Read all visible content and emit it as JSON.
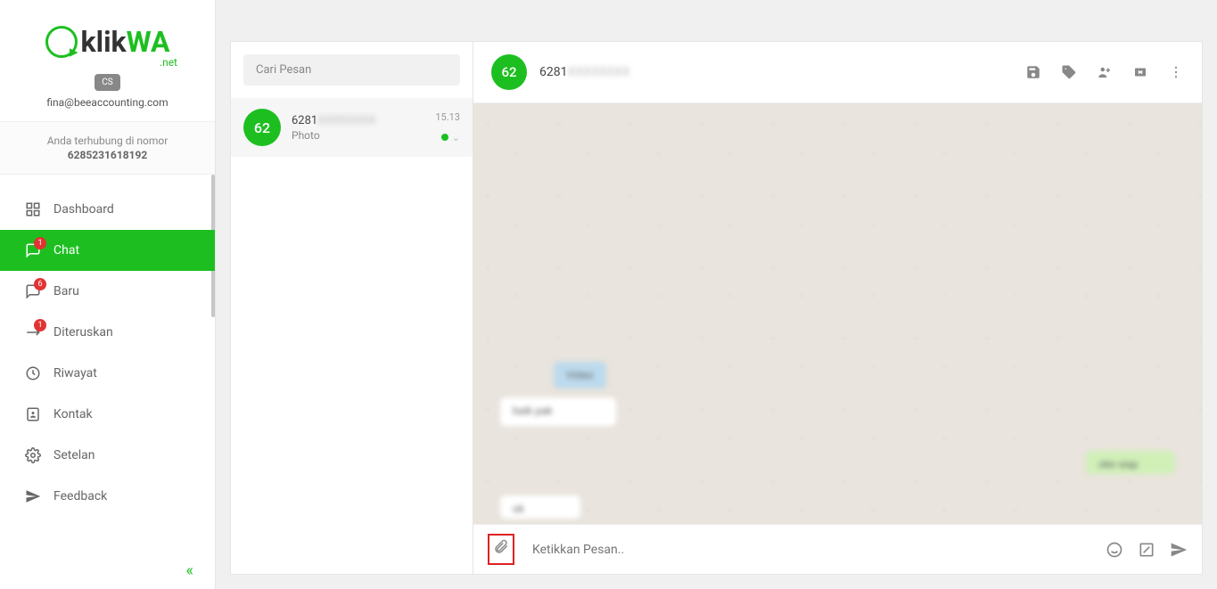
{
  "brand": {
    "name_pre": "klik",
    "name_wa": "WA",
    "suffix": ".net"
  },
  "user": {
    "badge": "CS",
    "email": "fina@beeaccounting.com"
  },
  "connection": {
    "label": "Anda terhubung di nomor",
    "number": "6285231618192"
  },
  "nav": {
    "dashboard": "Dashboard",
    "chat": {
      "label": "Chat",
      "badge": "1"
    },
    "baru": {
      "label": "Baru",
      "badge": "6"
    },
    "diteruskan": {
      "label": "Diteruskan",
      "badge": "1"
    },
    "riwayat": "Riwayat",
    "kontak": "Kontak",
    "setelan": "Setelan",
    "feedback": "Feedback"
  },
  "search": {
    "placeholder": "Cari Pesan"
  },
  "chatlist": {
    "items": [
      {
        "avatar": "62",
        "name_prefix": "6281",
        "name_blur": "XXXXXXXX",
        "preview": "Photo",
        "time": "15.13"
      }
    ]
  },
  "chat": {
    "header": {
      "avatar": "62",
      "title_prefix": "6281",
      "title_blur": "XXXXXXXX"
    },
    "input_placeholder": "Ketikkan Pesan.."
  }
}
